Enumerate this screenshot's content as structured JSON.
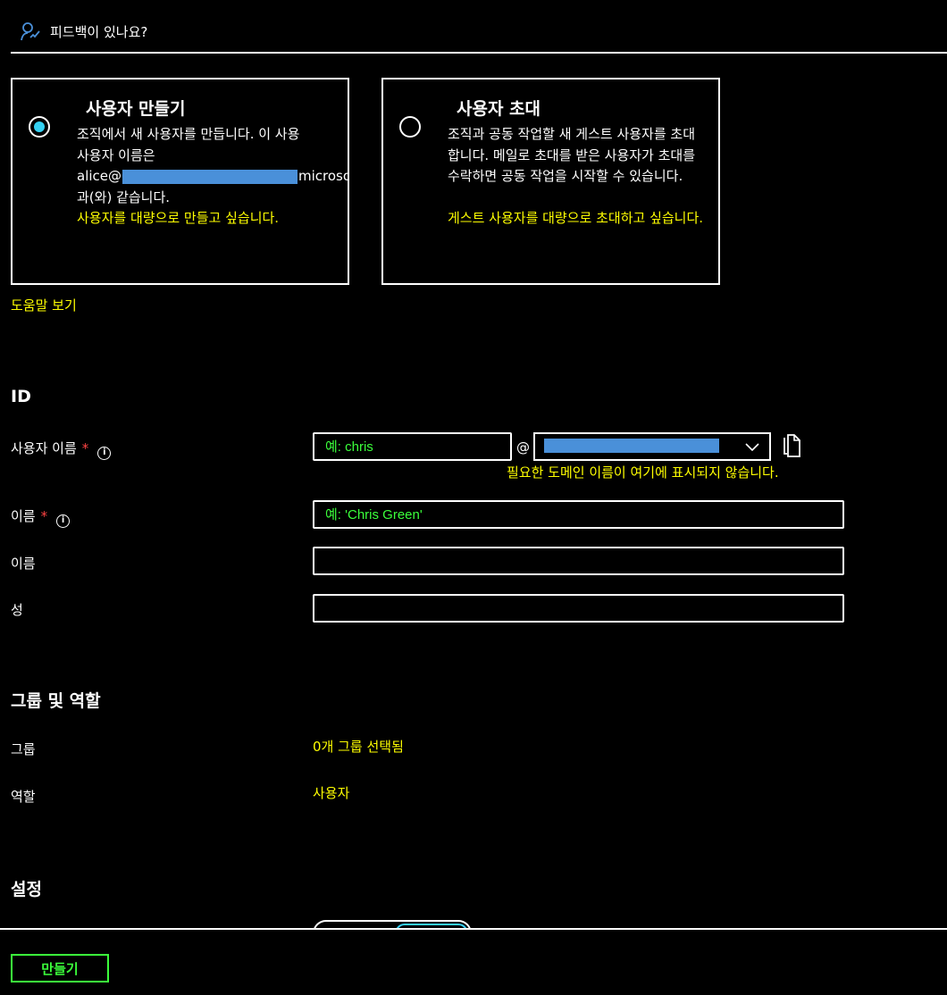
{
  "topbar": {
    "feedback_label": "피드백이 있나요?",
    "feedback_icon": "feedback-person-icon"
  },
  "options": {
    "create": {
      "title": "사용자 만들기",
      "desc_line1": "조직에서 새 사용자를 만듭니다. 이 사용",
      "desc_line2": "사용자 이름은",
      "desc_email_prefix": "alice@",
      "desc_email_suffix": "microso",
      "desc_line4": "과(와) 같습니다.",
      "bulk_link": "사용자를 대량으로 만들고 싶습니다.",
      "selected": true
    },
    "invite": {
      "title": "사용자 초대",
      "desc": "조직과 공동 작업할 새 게스트 사용자를 초대합니다. 메일로 초대를 받은 사용자가 초대를 수락하면 공동 작업을 시작할 수 있습니다.",
      "bulk_link": "게스트 사용자를 대량으로 초대하고 싶습니다.",
      "selected": false
    }
  },
  "help_link": "도움말 보기",
  "identity": {
    "section_title": "ID",
    "username": {
      "label": "사용자 이름",
      "required": "*",
      "placeholder": "예: chris",
      "at": "@"
    },
    "domain_warning": "필요한 도메인 이름이 여기에 표시되지 않습니다.",
    "name": {
      "label": "이름",
      "required": "*",
      "placeholder": "예: 'Chris Green'"
    },
    "first_name": {
      "label": "이름",
      "value": ""
    },
    "last_name": {
      "label": "성",
      "value": ""
    }
  },
  "groups_roles": {
    "section_title": "그룹 및 역할",
    "groups_label": "그룹",
    "groups_value": "0개 그룹 선택됨",
    "roles_label": "역할",
    "roles_value": "사용자"
  },
  "settings": {
    "section_title": "설정"
  },
  "footer": {
    "create_button": "만들기"
  },
  "colors": {
    "accent_cyan": "#35d1f3",
    "link_yellow": "#ffff00",
    "input_green": "#3bff3b",
    "required_red": "#ff4343",
    "redaction_blue": "#4a90d9"
  }
}
